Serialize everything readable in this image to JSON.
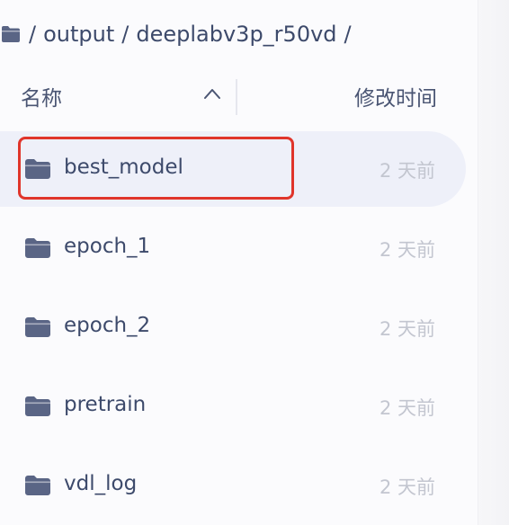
{
  "breadcrumb": {
    "segments": [
      "output",
      "deeplabv3p_r50vd"
    ],
    "separator": "/",
    "icon": "folder-icon"
  },
  "header": {
    "name_label": "名称",
    "mtime_label": "修改时间",
    "sort_icon": "chevron-up-icon"
  },
  "files": [
    {
      "name": "best_model",
      "mtime": "2 天前",
      "selected": true,
      "highlighted": true
    },
    {
      "name": "epoch_1",
      "mtime": "2 天前"
    },
    {
      "name": "epoch_2",
      "mtime": "2 天前"
    },
    {
      "name": "pretrain",
      "mtime": "2 天前"
    },
    {
      "name": "vdl_log",
      "mtime": "2 天前"
    }
  ],
  "colors": {
    "text": "#3d4a6b",
    "folder": "#5a6585",
    "muted": "#c3c6d0",
    "selected_bg": "#eef0f9",
    "highlight": "#e0352b"
  }
}
